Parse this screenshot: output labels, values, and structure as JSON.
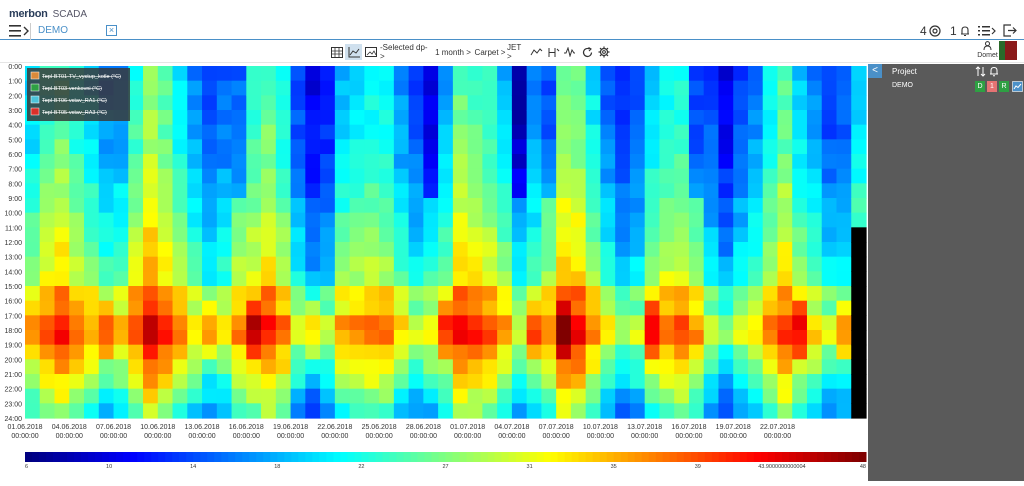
{
  "app": {
    "brand": "merbon",
    "product": "SCADA"
  },
  "tab": {
    "label": "DEMO",
    "close_glyph": "×"
  },
  "top_right": {
    "watch_count": "4",
    "alarm_count": "1"
  },
  "toolbar": {
    "selected_dp": "-Selected dp- >",
    "range": "1 month >",
    "view": "Carpet >",
    "colormap": "JET >"
  },
  "user": {
    "name": "Domet"
  },
  "sidebar": {
    "title": "Project",
    "row_label": "DEMO",
    "badges": [
      "D",
      "1",
      "R"
    ],
    "badge_colors": [
      "#2ea043",
      "#e57373",
      "#2ea043"
    ]
  },
  "chart_data": {
    "type": "heatmap",
    "x_start": "01.06.2018",
    "x_end": "27.07.2018",
    "x_tick_labels": [
      "01.06.2018",
      "04.06.2018",
      "07.06.2018",
      "10.06.2018",
      "13.06.2018",
      "16.06.2018",
      "19.06.2018",
      "22.06.2018",
      "25.06.2018",
      "28.06.2018",
      "01.07.2018",
      "04.07.2018",
      "07.07.2018",
      "10.07.2018",
      "13.07.2018",
      "16.07.2018",
      "19.07.2018",
      "22.07.2018"
    ],
    "x_tick_time": "00:00:00",
    "y_tick_labels": [
      "0:00",
      "1:00",
      "2:00",
      "3:00",
      "4:00",
      "5:00",
      "6:00",
      "7:00",
      "8:00",
      "9:00",
      "10:00",
      "11:00",
      "12:00",
      "13:00",
      "14:00",
      "15:00",
      "16:00",
      "17:00",
      "18:00",
      "19:00",
      "20:00",
      "21:00",
      "22:00",
      "23:00",
      "24:00"
    ],
    "legend": [
      {
        "name": "Tepl-BT01-TV_vystup_kotle (°C)",
        "color": "#d98a3a"
      },
      {
        "name": "Tepl-BT03-venkovni (°C)",
        "color": "#2ea043"
      },
      {
        "name": "Tepl-BT06-vstav_RA1 (°C)",
        "color": "#4cc3d9"
      },
      {
        "name": "Tepl-BT05-vstav_RA3 (°C)",
        "color": "#d9302a"
      }
    ],
    "colorbar": {
      "colormap": "JET",
      "min": 6,
      "max": 48,
      "tick_labels": [
        "6",
        "10",
        "14",
        "18",
        "22",
        "27",
        "31",
        "35",
        "39",
        "43.9000000000004",
        "48"
      ]
    },
    "missing_after": "27.07.2018 12:00"
  }
}
